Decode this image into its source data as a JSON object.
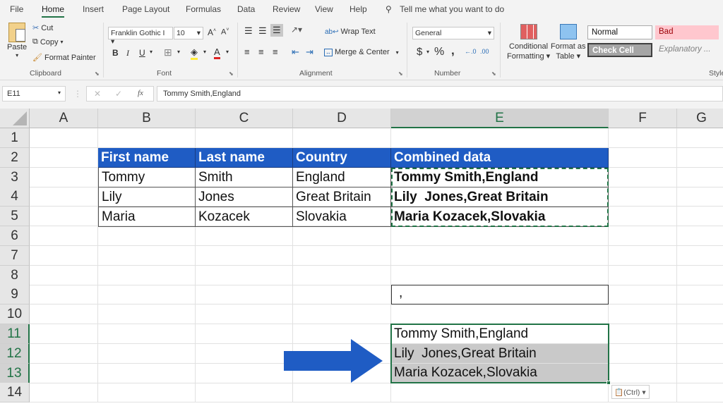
{
  "menu": {
    "tabs": [
      "File",
      "Home",
      "Insert",
      "Page Layout",
      "Formulas",
      "Data",
      "Review",
      "View",
      "Help"
    ],
    "active": "Home",
    "tell_me": "Tell me what you want to do"
  },
  "ribbon": {
    "clipboard": {
      "paste": "Paste",
      "cut": "Cut",
      "copy": "Copy",
      "format_painter": "Format Painter",
      "label": "Clipboard"
    },
    "font": {
      "font_name": "Franklin Gothic I",
      "font_size": "10",
      "bold": "B",
      "italic": "I",
      "underline": "U",
      "label": "Font"
    },
    "alignment": {
      "wrap_text": "Wrap Text",
      "merge_center": "Merge & Center",
      "label": "Alignment"
    },
    "number": {
      "format": "General",
      "currency": "$",
      "percent": "%",
      "comma": ",",
      "label": "Number"
    },
    "styles": {
      "conditional_formatting_1": "Conditional",
      "conditional_formatting_2": "Formatting",
      "format_as_table_1": "Format as",
      "format_as_table_2": "Table",
      "normal": "Normal",
      "bad": "Bad",
      "check_cell": "Check Cell",
      "explanatory": "Explanatory ...",
      "label": "Style"
    }
  },
  "formula_bar": {
    "name_box": "E11",
    "formula": "Tommy Smith,England",
    "fx": "fx"
  },
  "columns": [
    "A",
    "B",
    "C",
    "D",
    "E",
    "F",
    "G"
  ],
  "selected_column": "E",
  "rows": [
    "1",
    "2",
    "3",
    "4",
    "5",
    "6",
    "7",
    "8",
    "9",
    "10",
    "11",
    "12",
    "13",
    "14"
  ],
  "selected_rows": [
    "11",
    "12",
    "13"
  ],
  "table": {
    "headers": [
      "First name",
      "Last name",
      "Country",
      "Combined data"
    ],
    "rows": [
      [
        "Tommy",
        "Smith",
        "England",
        "Tommy Smith,England"
      ],
      [
        "Lily",
        "Jones",
        "Great Britain",
        "Lily  Jones,Great Britain"
      ],
      [
        "Maria",
        "Kozacek",
        "Slovakia",
        "Maria Kozacek,Slovakia"
      ]
    ]
  },
  "e9_value": ",",
  "result_cells": [
    "Tommy Smith,England",
    "Lily  Jones,Great Britain",
    "Maria Kozacek,Slovakia"
  ],
  "paste_options": "(Ctrl)",
  "colors": {
    "header_blue": "#1f5cc4",
    "excel_green": "#217346",
    "arrow_blue": "#1f5cc4"
  }
}
